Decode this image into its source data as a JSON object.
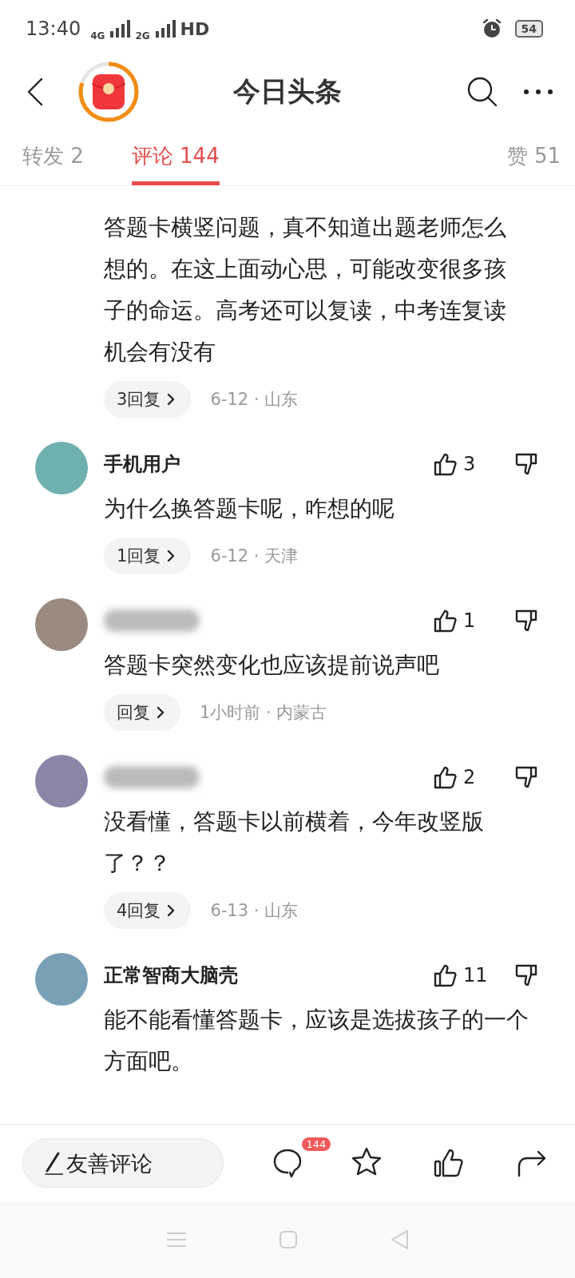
{
  "status_bar": {
    "time": "13:40",
    "networks": [
      "4G",
      "2G"
    ],
    "hd": "HD",
    "battery": "54"
  },
  "header": {
    "title": "今日头条",
    "reward": {
      "level": 0.8
    }
  },
  "tabs": [
    {
      "label": "转发 2",
      "selected": false
    },
    {
      "label": "评论 144",
      "selected": true
    },
    {
      "label": "赞 51",
      "selected": false
    }
  ],
  "comments": [
    {
      "kind": "partial",
      "text": "答题卡横竖问题，真不知道出题老师怎么想的。在这上面动心思，可能改变很多孩子的命运。高考还可以复读，中考连复读机会有没有",
      "replies": "3回复",
      "meta": "6-12 · 山东"
    },
    {
      "kind": "full",
      "color": "#6fb0b0",
      "name": "手机用户",
      "likes": "3",
      "text": "为什么换答题卡呢，咋想的呢",
      "replies": "1回复",
      "meta": "6-12 · 天津"
    },
    {
      "kind": "full",
      "color": "#9a8a80",
      "likes": "1",
      "text": "答题卡突然变化也应该提前说声吧",
      "replies": "回复",
      "meta": "1小时前 · 内蒙古"
    },
    {
      "kind": "full",
      "color": "#8a86a8",
      "likes": "2",
      "text": "没看懂，答题卡以前横着，今年改竖版了？？",
      "replies": "4回复",
      "meta": "6-13 · 山东"
    },
    {
      "kind": "full",
      "color": "#7aa0b8",
      "name": "正常智商大脑壳",
      "likes": "11",
      "text": "能不能看懂答题卡，应该是选拔孩子的一个方面吧。"
    }
  ],
  "bottom_bar": {
    "placeholder": "友善评论",
    "comment_count": "144"
  }
}
